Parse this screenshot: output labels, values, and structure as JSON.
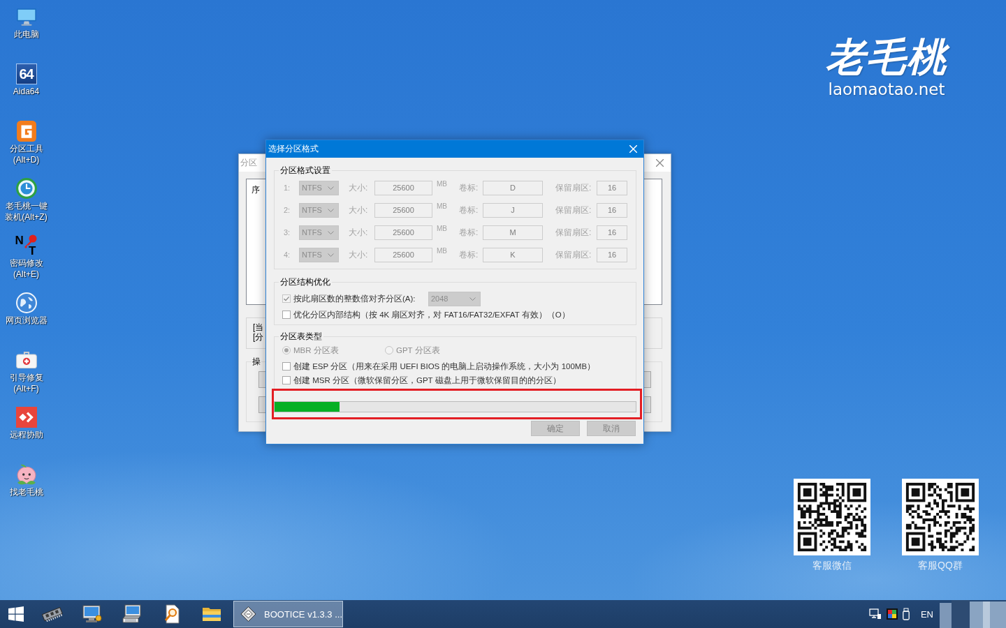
{
  "desktop_icons": [
    {
      "kind": "computer",
      "lines": [
        "此电脑"
      ]
    },
    {
      "kind": "aida",
      "logo_text": "64",
      "lines": [
        "Aida64"
      ]
    },
    {
      "kind": "partition",
      "lines": [
        "分区工具",
        "(Alt+D)"
      ]
    },
    {
      "kind": "installer",
      "lines": [
        "老毛桃一键",
        "装机(Alt+Z)"
      ]
    },
    {
      "kind": "password",
      "logo_letters": [
        "N",
        "T"
      ],
      "lines": [
        "密码修改",
        "(Alt+E)"
      ]
    },
    {
      "kind": "browser",
      "lines": [
        "网页浏览器"
      ]
    },
    {
      "kind": "repair",
      "lines": [
        "引导修复",
        "(Alt+F)"
      ]
    },
    {
      "kind": "remote",
      "lines": [
        "远程协助"
      ]
    },
    {
      "kind": "mascot",
      "lines": [
        "找老毛桃"
      ]
    }
  ],
  "logo": {
    "name": "老毛桃",
    "site": "laomaotao.net"
  },
  "background_window": {
    "title": "分区",
    "list_header": "序",
    "info_lines": [
      "[当",
      "[分"
    ],
    "group_title": "操"
  },
  "dialog": {
    "title": "选择分区格式",
    "format_group": {
      "title": "分区格式设置",
      "rows": [
        {
          "index": "1:",
          "file_system": "NTFS",
          "size_caption": "大小:",
          "size": "25600",
          "unit": "MB",
          "volume_caption": "卷标:",
          "volume_label": "D",
          "reserved_caption": "保留扇区:",
          "reserved": "16",
          "disabled": true
        },
        {
          "index": "2:",
          "file_system": "NTFS",
          "size_caption": "大小:",
          "size": "25600",
          "unit": "MB",
          "volume_caption": "卷标:",
          "volume_label": "J",
          "reserved_caption": "保留扇区:",
          "reserved": "16",
          "disabled": true
        },
        {
          "index": "3:",
          "file_system": "NTFS",
          "size_caption": "大小:",
          "size": "25600",
          "unit": "MB",
          "volume_caption": "卷标:",
          "volume_label": "M",
          "reserved_caption": "保留扇区:",
          "reserved": "16",
          "disabled": true
        },
        {
          "index": "4:",
          "file_system": "NTFS",
          "size_caption": "大小:",
          "size": "25600",
          "unit": "MB",
          "volume_caption": "卷标:",
          "volume_label": "K",
          "reserved_caption": "保留扇区:",
          "reserved": "16",
          "disabled": true
        }
      ]
    },
    "structure_group": {
      "title": "分区结构优化",
      "options": [
        {
          "kind": "combo",
          "label": "按此扇区数的整数倍对齐分区(A):",
          "checked": true,
          "value": "2048"
        },
        {
          "kind": "checkbox",
          "label": "优化分区内部结构（按 4K 扇区对齐，对 FAT16/FAT32/EXFAT 有效）（O）",
          "checked": false
        }
      ]
    },
    "table_type_group": {
      "title": "分区表类型",
      "radios": [
        {
          "label": "MBR 分区表",
          "selected": true,
          "disabled": true
        },
        {
          "label": "GPT 分区表",
          "selected": false,
          "disabled": true
        }
      ],
      "options": [
        {
          "label": "创建 ESP 分区（用来在采用 UEFI BIOS 的电脑上启动操作系统，大小为 100MB）",
          "checked": false
        },
        {
          "label": "创建 MSR 分区（微软保留分区，GPT 磁盘上用于微软保留目的的分区）",
          "checked": false
        }
      ]
    },
    "progress": {
      "level": 0.18
    },
    "buttons": [
      {
        "label": "确定",
        "disabled": true
      },
      {
        "label": "取消",
        "disabled": true
      }
    ]
  },
  "qr_codes": [
    {
      "caption": "客服微信"
    },
    {
      "caption": "客服QQ群"
    }
  ],
  "taskbar": {
    "tasks": [
      {
        "label": "BOOTICE v1.3.3 ...",
        "selected": true
      }
    ],
    "language": "EN"
  }
}
